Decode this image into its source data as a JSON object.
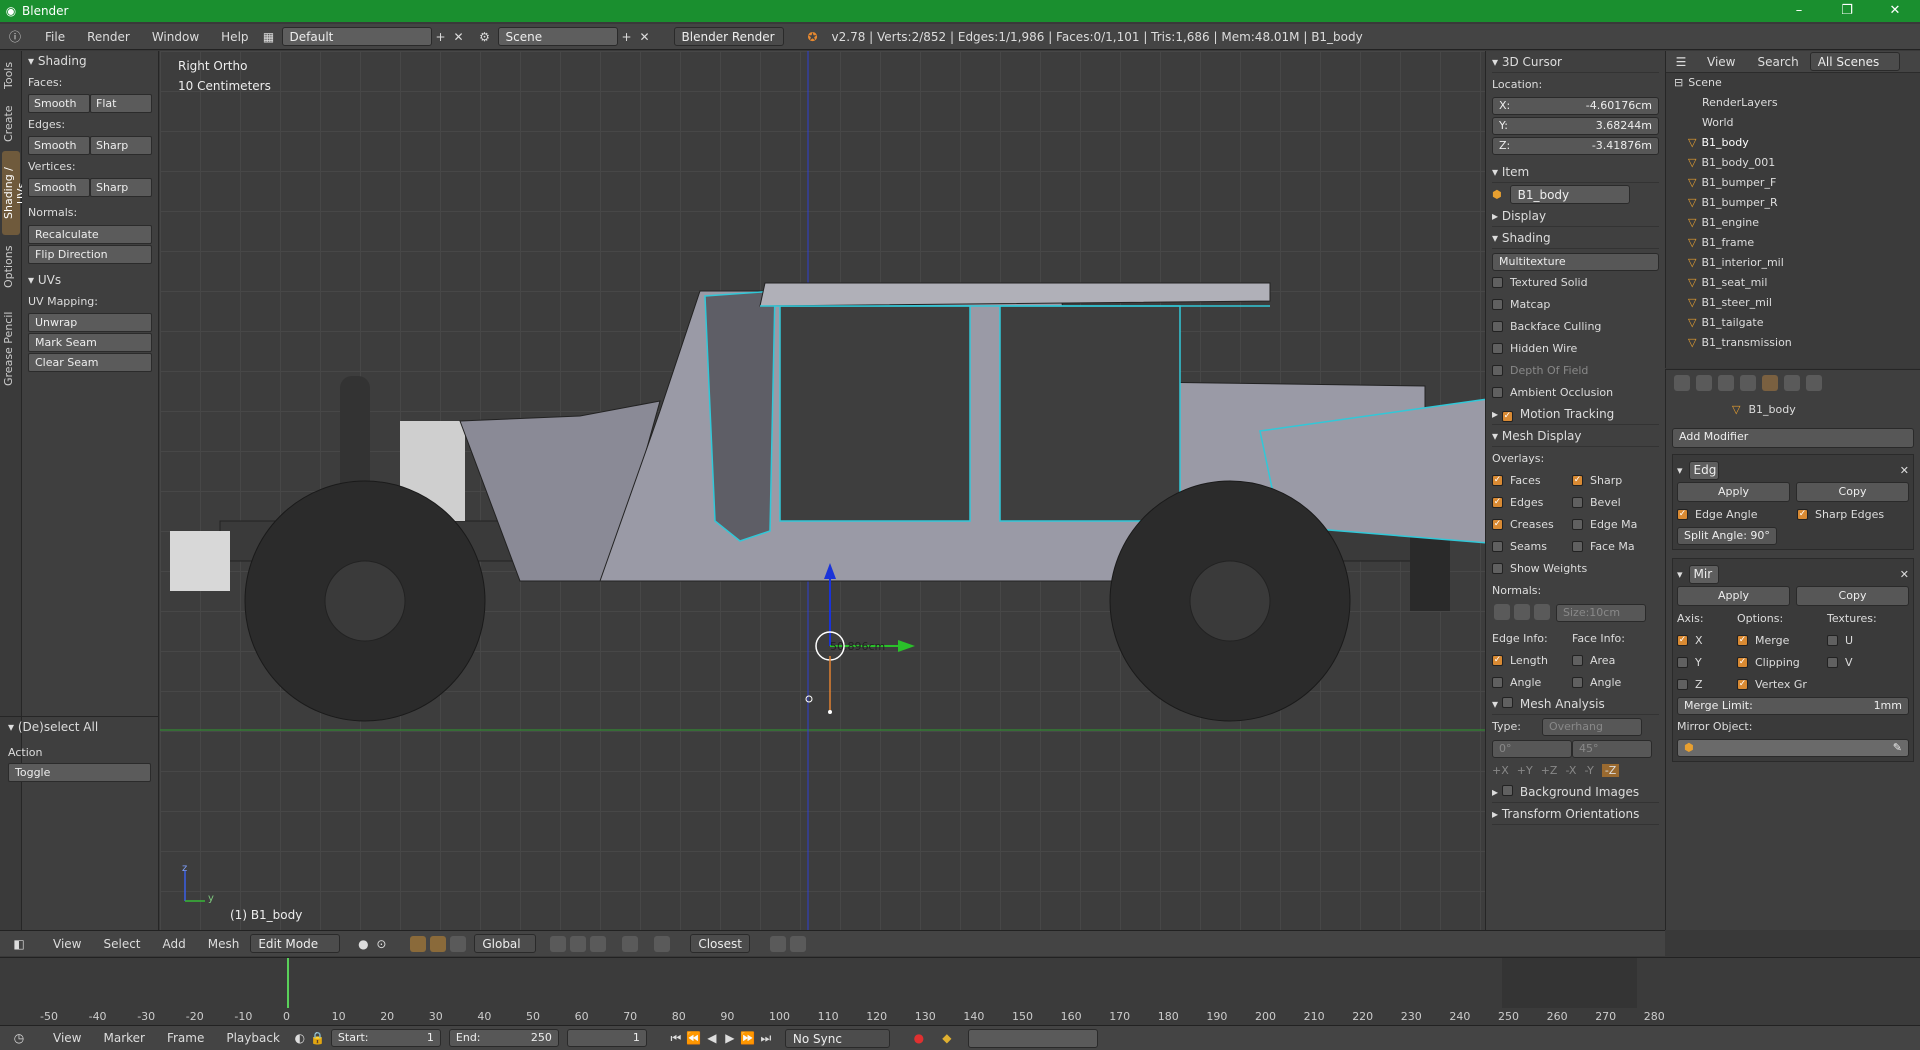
{
  "window": {
    "title": "Blender",
    "controls": [
      "–",
      "❐",
      "✕"
    ]
  },
  "topbar": {
    "menus": [
      "File",
      "Render",
      "Window",
      "Help"
    ],
    "layout": "Default",
    "scene": "Scene",
    "engine": "Blender Render",
    "stats": "v2.78 | Verts:2/852 | Edges:1/1,986 | Faces:0/1,101 | Tris:1,686 | Mem:48.01M | B1_body"
  },
  "tool_tabs": [
    "Tools",
    "Create",
    "Shading / UVs",
    "Options",
    "Grease Pencil"
  ],
  "toolshelf": {
    "shading_title": "Shading",
    "faces_label": "Faces:",
    "edges_label": "Edges:",
    "vertices_label": "Vertices:",
    "smooth": "Smooth",
    "flat": "Flat",
    "sharp": "Sharp",
    "normals_label": "Normals:",
    "recalculate": "Recalculate",
    "flip_direction": "Flip Direction",
    "uvs_title": "UVs",
    "uv_mapping_label": "UV Mapping:",
    "unwrap": "Unwrap",
    "mark_seam": "Mark Seam",
    "clear_seam": "Clear Seam",
    "operator_title": "(De)select All",
    "action_label": "Action",
    "action_value": "Toggle"
  },
  "viewport": {
    "view_name": "Right Ortho",
    "scale": "10 Centimeters",
    "object_label": "(1) B1_body",
    "measure": "50.896cm",
    "axis_y": "y",
    "axis_z": "z"
  },
  "npanel": {
    "cursor_title": "3D Cursor",
    "location_label": "Location:",
    "x_label": "X:",
    "x_value": "-4.60176cm",
    "y_label": "Y:",
    "y_value": "3.68244m",
    "z_label": "Z:",
    "z_value": "-3.41876m",
    "item_title": "Item",
    "item_name": "B1_body",
    "display_title": "Display",
    "shading_title": "Shading",
    "shading_mode": "Multitexture",
    "shading_options": [
      "Textured Solid",
      "Matcap",
      "Backface Culling",
      "Hidden Wire",
      "Depth Of Field",
      "Ambient Occlusion"
    ],
    "motion_tracking": "Motion Tracking",
    "mesh_display": "Mesh Display",
    "overlays_label": "Overlays:",
    "overlays_left": [
      "Faces",
      "Edges",
      "Creases",
      "Seams",
      "Show Weights"
    ],
    "overlays_right": [
      "Sharp",
      "Bevel",
      "Edge Ma",
      "Face Ma"
    ],
    "normals_label": "Normals:",
    "normals_size": "Size:10cm",
    "edge_info_label": "Edge Info:",
    "face_info_label": "Face Info:",
    "edge_info": [
      "Length",
      "Angle"
    ],
    "face_info": [
      "Area",
      "Angle"
    ],
    "mesh_analysis": "Mesh Analysis",
    "type_label": "Type:",
    "type_value": "Overhang",
    "angle_min": "0°",
    "angle_max": "45°",
    "axes": [
      "+X",
      "+Y",
      "+Z",
      "-X",
      "-Y",
      "-Z"
    ],
    "background_images": "Background Images",
    "transform_orientations": "Transform Orientations"
  },
  "outliner": {
    "view": "View",
    "search": "Search",
    "filter": "All Scenes",
    "scene": "Scene",
    "items": [
      "RenderLayers",
      "World",
      "B1_body",
      "B1_body_001",
      "B1_bumper_F",
      "B1_bumper_R",
      "B1_engine",
      "B1_frame",
      "B1_interior_mil",
      "B1_seat_mil",
      "B1_steer_mil",
      "B1_tailgate",
      "B1_transmission"
    ]
  },
  "properties": {
    "object_name": "B1_body",
    "add_modifier": "Add Modifier",
    "mod1_name": "Edg",
    "apply": "Apply",
    "copy": "Copy",
    "edge_angle": "Edge Angle",
    "sharp_edges": "Sharp Edges",
    "split_angle": "Split Angle: 90°",
    "mod2_name": "Mir",
    "axis_label": "Axis:",
    "options_label": "Options:",
    "textures_label": "Textures:",
    "axis": [
      "X",
      "Y",
      "Z"
    ],
    "options": [
      "Merge",
      "Clipping",
      "Vertex Gr"
    ],
    "textures": [
      "U",
      "V"
    ],
    "merge_limit_label": "Merge Limit:",
    "merge_limit_value": "1mm",
    "mirror_object": "Mirror Object:"
  },
  "view_header": {
    "menus": [
      "View",
      "Select",
      "Add",
      "Mesh"
    ],
    "mode": "Edit Mode",
    "orientation": "Global",
    "snap": "Closest"
  },
  "timeline": {
    "ticks": [
      "-50",
      "-40",
      "-30",
      "-20",
      "-10",
      "0",
      "10",
      "20",
      "30",
      "40",
      "50",
      "60",
      "70",
      "80",
      "90",
      "100",
      "110",
      "120",
      "130",
      "140",
      "150",
      "160",
      "170",
      "180",
      "190",
      "200",
      "210",
      "220",
      "230",
      "240",
      "250",
      "260",
      "270",
      "280"
    ],
    "menus": [
      "View",
      "Marker",
      "Frame",
      "Playback"
    ],
    "start_label": "Start:",
    "start_value": "1",
    "end_label": "End:",
    "end_value": "250",
    "current": "1",
    "sync": "No Sync"
  },
  "colors": {
    "title_bar": "#1a8f2f",
    "accent": "#d98a33",
    "selection": "#31c8d8"
  }
}
